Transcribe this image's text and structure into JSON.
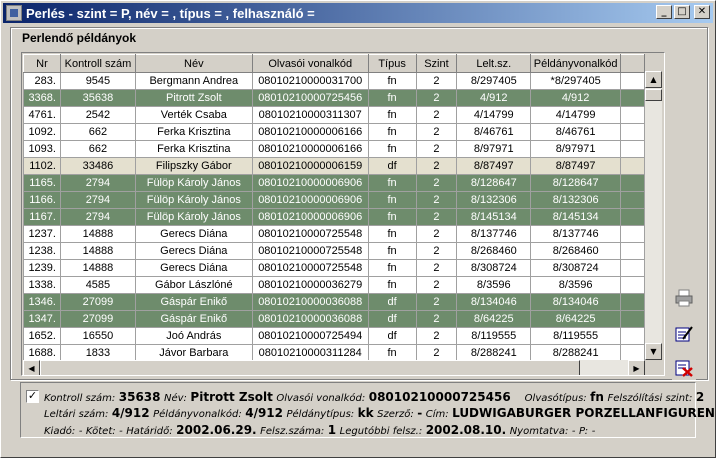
{
  "window": {
    "title": "Perlés - szint = P, név = , típus = , felhasználó =",
    "min_label": "_",
    "max_label": "□",
    "close_label": "✕"
  },
  "group": {
    "title": "Perlendő példányok"
  },
  "table": {
    "headers": [
      "Nr",
      "Kontroll szám",
      "Név",
      "Olvasói vonalkód",
      "Típus",
      "Szint",
      "Lelt.sz.",
      "Példányvonalkód"
    ],
    "rows": [
      {
        "style": "white",
        "cells": [
          "283.",
          "9545",
          "Bergmann Andrea",
          "08010210000031700",
          "fn",
          "2",
          "8/297405",
          "*8/297405"
        ]
      },
      {
        "style": "green",
        "cells": [
          "3368.",
          "35638",
          "Pitrott Zsolt",
          "08010210000725456",
          "fn",
          "2",
          "4/912",
          "4/912"
        ]
      },
      {
        "style": "white",
        "cells": [
          "4761.",
          "2542",
          "Verték Csaba",
          "08010210000311307",
          "fn",
          "2",
          "4/14799",
          "4/14799"
        ]
      },
      {
        "style": "white",
        "cells": [
          "1092.",
          "662",
          "Ferka Krisztina",
          "08010210000006166",
          "fn",
          "2",
          "8/46761",
          "8/46761"
        ]
      },
      {
        "style": "white",
        "cells": [
          "1093.",
          "662",
          "Ferka Krisztina",
          "08010210000006166",
          "fn",
          "2",
          "8/97971",
          "8/97971"
        ]
      },
      {
        "style": "beige",
        "cells": [
          "1102.",
          "33486",
          "Filipszky Gábor",
          "08010210000006159",
          "df",
          "2",
          "8/87497",
          "8/87497"
        ]
      },
      {
        "style": "green",
        "cells": [
          "1165.",
          "2794",
          "Fülöp Károly János",
          "08010210000006906",
          "fn",
          "2",
          "8/128647",
          "8/128647"
        ]
      },
      {
        "style": "green",
        "cells": [
          "1166.",
          "2794",
          "Fülöp Károly János",
          "08010210000006906",
          "fn",
          "2",
          "8/132306",
          "8/132306"
        ]
      },
      {
        "style": "green",
        "cells": [
          "1167.",
          "2794",
          "Fülöp Károly János",
          "08010210000006906",
          "fn",
          "2",
          "8/145134",
          "8/145134"
        ]
      },
      {
        "style": "white",
        "cells": [
          "1237.",
          "14888",
          "Gerecs Diána",
          "08010210000725548",
          "fn",
          "2",
          "8/137746",
          "8/137746"
        ]
      },
      {
        "style": "white",
        "cells": [
          "1238.",
          "14888",
          "Gerecs Diána",
          "08010210000725548",
          "fn",
          "2",
          "8/268460",
          "8/268460"
        ]
      },
      {
        "style": "white",
        "cells": [
          "1239.",
          "14888",
          "Gerecs Diána",
          "08010210000725548",
          "fn",
          "2",
          "8/308724",
          "8/308724"
        ]
      },
      {
        "style": "white",
        "cells": [
          "1338.",
          "4585",
          "Gábor Lászlóné",
          "08010210000036279",
          "fn",
          "2",
          "8/3596",
          "8/3596"
        ]
      },
      {
        "style": "green",
        "cells": [
          "1346.",
          "27099",
          "Gáspár Enikő",
          "08010210000036088",
          "df",
          "2",
          "8/134046",
          "8/134046"
        ]
      },
      {
        "style": "green",
        "cells": [
          "1347.",
          "27099",
          "Gáspár Enikő",
          "08010210000036088",
          "df",
          "2",
          "8/64225",
          "8/64225"
        ]
      },
      {
        "style": "white",
        "cells": [
          "1652.",
          "16550",
          "Joó András",
          "08010210000725494",
          "df",
          "2",
          "8/119555",
          "8/119555"
        ]
      },
      {
        "style": "white",
        "cells": [
          "1688.",
          "1833",
          "Jávor Barbara",
          "08010210000311284",
          "fn",
          "2",
          "8/288241",
          "8/288241"
        ]
      },
      {
        "style": "beige",
        "cells": [
          "1701.",
          "23484",
          "Jávor Gergely",
          "08010210000727467",
          "df",
          "2",
          "8/127650",
          "8/127650"
        ]
      }
    ]
  },
  "scroll": {
    "up": "▲",
    "down": "▼",
    "left": "◀",
    "right": "▶"
  },
  "detail": {
    "checked_mark": "✓",
    "line1": {
      "kontroll_label": "Kontroll szám:",
      "kontroll_value": "35638",
      "nev_label": "Név:",
      "nev_value": "Pitrott Zsolt",
      "vonalkod_label": "Olvasói vonalkód:",
      "vonalkod_value": "08010210000725456",
      "tipus_label": "Olvasótípus:",
      "tipus_value": "fn",
      "szint_label": "Felszólítási szint:",
      "szint_value": "2"
    },
    "line2": {
      "lelt_label": "Leltári szám:",
      "lelt_value": "4/912",
      "pvk_label": "Példányvonalkód:",
      "pvk_value": "4/912",
      "ptipus_label": "Példánytípus:",
      "ptipus_value": "kk",
      "szerzo_label": "Szerző:",
      "szerzo_value": "-",
      "cim_label": "Cím:",
      "cim_value": "LUDWIGABURGER PORZELLANFIGUREN"
    },
    "line3": {
      "kiado_label": "Kiadó:",
      "kiado_value": "-",
      "kotet_label": "Kötet:",
      "kotet_value": "-",
      "hatarido_label": "Határidő:",
      "hatarido_value": "2002.06.29.",
      "felsz_label": "Felsz.száma:",
      "felsz_value": "1",
      "legutobbi_label": "Legutóbbi felsz.:",
      "legutobbi_value": "2002.08.10.",
      "nyomtatva_label": "Nyomtatva:",
      "nyomtatva_value": "-",
      "p_label": "P:",
      "p_value": "-"
    }
  }
}
